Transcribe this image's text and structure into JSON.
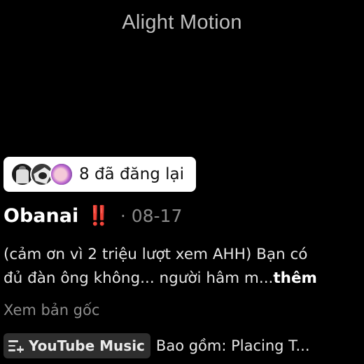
{
  "watermark": "Alight Motion",
  "repost": {
    "text": "8 đã đăng lại"
  },
  "post": {
    "author": "Obanai",
    "emoji": "‼️",
    "separator_date": "· 08-17",
    "caption_line1": "(cảm ơn vì 2 triệu lượt xem AHH) Bạn có",
    "caption_line2": "đủ đàn ông không... người hâm m...",
    "more_label": "thêm",
    "see_original": "Xem bản gốc"
  },
  "music": {
    "icon": "playlist-add-icon",
    "label": "YouTube Music",
    "includes": "Bao gồm: Placing T..."
  },
  "colors": {
    "background": "#000000",
    "pill_background": "#ffffff",
    "emoji_red": "#e03131",
    "muted_text": "#8a8a8a",
    "chip_background": "#2e2e2e"
  }
}
